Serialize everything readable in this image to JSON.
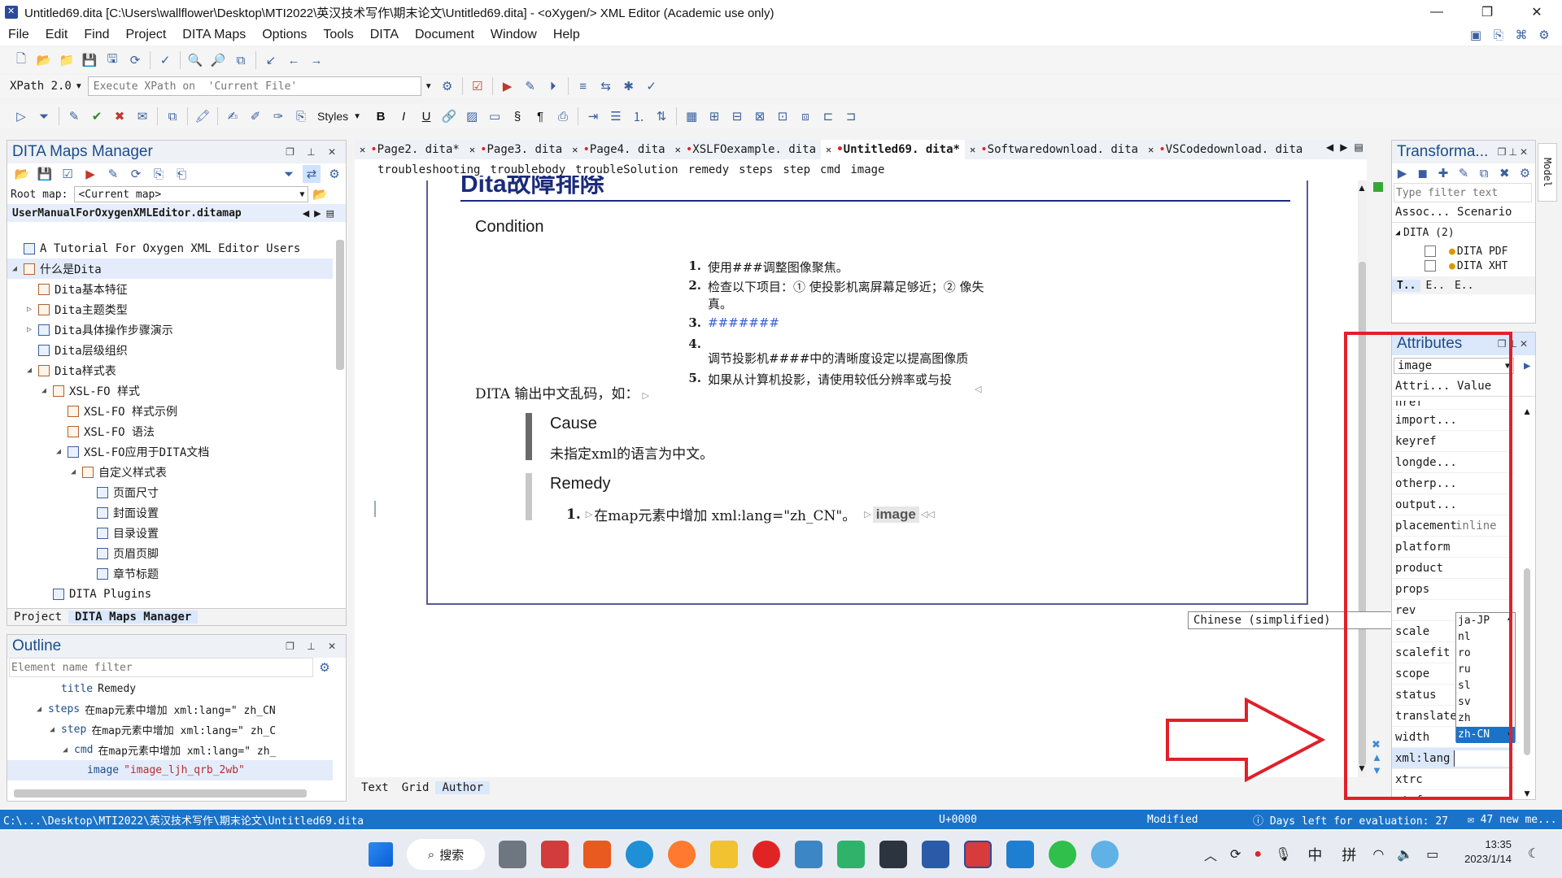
{
  "window": {
    "title": "Untitled69.dita [C:\\Users\\wallflower\\Desktop\\MTI2022\\英汉技术写作\\期末论文\\Untitled69.dita] - <oXygen/> XML Editor (Academic use only)",
    "minimize": "—",
    "maximize": "❐",
    "close": "✕"
  },
  "menu": [
    "File",
    "Edit",
    "Find",
    "Project",
    "DITA Maps",
    "Options",
    "Tools",
    "DITA",
    "Document",
    "Window",
    "Help"
  ],
  "xpath": {
    "version": "XPath 2.0",
    "placeholder": "Execute XPath on  'Current File'"
  },
  "toolbar2": {
    "styles_label": "Styles"
  },
  "dita_maps": {
    "title": "DITA Maps Manager",
    "root_label": "Root map:",
    "root_value": "<Current map>",
    "map_tab": "UserManualForOxygenXMLEditor.ditamap",
    "tree": [
      {
        "label": "A Tutorial For Oxygen XML Editor Users",
        "indent": 0,
        "tw": "",
        "type": "map"
      },
      {
        "label": "什么是Dita",
        "indent": 0,
        "tw": "◢",
        "type": "topic"
      },
      {
        "label": "Dita基本特征",
        "indent": 1,
        "tw": "",
        "type": "topic"
      },
      {
        "label": "Dita主题类型",
        "indent": 1,
        "tw": "▷",
        "type": "topic"
      },
      {
        "label": "Dita具体操作步骤演示",
        "indent": 1,
        "tw": "▷",
        "type": "map"
      },
      {
        "label": "Dita层级组织",
        "indent": 1,
        "tw": "",
        "type": "map"
      },
      {
        "label": "Dita样式表",
        "indent": 1,
        "tw": "◢",
        "type": "topic"
      },
      {
        "label": "XSL-FO 样式",
        "indent": 2,
        "tw": "◢",
        "type": "topic"
      },
      {
        "label": "XSL-FO 样式示例",
        "indent": 3,
        "tw": "",
        "type": "topic"
      },
      {
        "label": "XSL-FO 语法",
        "indent": 3,
        "tw": "",
        "type": "topic"
      },
      {
        "label": "XSL-FO应用于DITA文档",
        "indent": 3,
        "tw": "◢",
        "type": "map"
      },
      {
        "label": "自定义样式表",
        "indent": 4,
        "tw": "◢",
        "type": "topic"
      },
      {
        "label": "页面尺寸",
        "indent": 5,
        "tw": "",
        "type": "map"
      },
      {
        "label": "封面设置",
        "indent": 5,
        "tw": "",
        "type": "map"
      },
      {
        "label": "目录设置",
        "indent": 5,
        "tw": "",
        "type": "map"
      },
      {
        "label": "页眉页脚",
        "indent": 5,
        "tw": "",
        "type": "map"
      },
      {
        "label": "章节标题",
        "indent": 5,
        "tw": "",
        "type": "map"
      },
      {
        "label": "DITA Plugins",
        "indent": 2,
        "tw": "",
        "type": "map"
      }
    ],
    "bottom_tabs": [
      "Project",
      "DITA Maps Manager"
    ]
  },
  "outline": {
    "title": "Outline",
    "filter_placeholder": "Element name filter",
    "rows": [
      {
        "tag": "title",
        "text": "Remedy",
        "indent": 3,
        "tw": ""
      },
      {
        "tag": "steps",
        "text": "在map元素中增加 xml:lang=\" zh_CN",
        "indent": 2,
        "tw": "◢"
      },
      {
        "tag": "step",
        "text": "在map元素中增加 xml:lang=\" zh_C",
        "indent": 3,
        "tw": "◢"
      },
      {
        "tag": "cmd",
        "text": "在map元素中增加 xml:lang=\" zh_",
        "indent": 4,
        "tw": "◢"
      },
      {
        "tag": "image",
        "text": "\"image_ljh_qrb_2wb\"",
        "indent": 5,
        "tw": ""
      }
    ]
  },
  "editor": {
    "tabs": [
      "Page2. dita*",
      "Page3. dita",
      "Page4. dita",
      "XSLFOexample. dita",
      "Untitled69. dita*",
      "Softwaredownload. dita",
      "VSCodedownload. dita"
    ],
    "active_tab": 4,
    "breadcrumb": [
      "troubleshooting",
      "troublebody",
      "troubleSolution",
      "remedy",
      "steps",
      "step",
      "cmd",
      "image"
    ],
    "doc_title": "Dita故障排除",
    "condition_heading": "Condition",
    "condition_items": [
      {
        "n": "1.",
        "text": "使用###调整图像聚焦。"
      },
      {
        "n": "2.",
        "text": "检查以下项目：① 使投影机离屏幕足够近；② 像失真。"
      },
      {
        "n": "3.",
        "text": "#######"
      },
      {
        "n": "4.",
        "text": "调节投影机####中的清晰度设定以提高图像质"
      },
      {
        "n": "5.",
        "text": "如果从计算机投影，请使用较低分辨率或与投"
      }
    ],
    "condition_para": "DITA 输出中文乱码，如：",
    "cause_heading": "Cause",
    "cause_text": "未指定xml的语言为中文。",
    "remedy_heading": "Remedy",
    "remedy_step_n": "1.",
    "remedy_step_text": "在map元素中增加 xml:lang=\"zh_CN\"。",
    "remedy_image_tag": "image",
    "mode_tabs": [
      "Text",
      "Grid",
      "Author"
    ],
    "tooltip": "Chinese (simplified)"
  },
  "transform": {
    "title": "Transforma...",
    "filter_placeholder": "Type filter text",
    "col_assoc": "Assoc...",
    "col_scenario": "Scenario",
    "group": "DITA (2)",
    "items": [
      "DITA PDF",
      "DITA XHT"
    ],
    "tab1": "T..",
    "tab2": "E..",
    "tab3": "E.."
  },
  "attributes": {
    "title": "Attributes",
    "element": "image",
    "col_attr": "Attri...",
    "col_value": "Value",
    "rows": [
      {
        "k": "href",
        "v": ""
      },
      {
        "k": "import...",
        "v": ""
      },
      {
        "k": "keyref",
        "v": ""
      },
      {
        "k": "longde...",
        "v": ""
      },
      {
        "k": "otherp...",
        "v": ""
      },
      {
        "k": "output...",
        "v": ""
      },
      {
        "k": "placement",
        "v": "inline"
      },
      {
        "k": "platform",
        "v": ""
      },
      {
        "k": "product",
        "v": ""
      },
      {
        "k": "props",
        "v": ""
      },
      {
        "k": "rev",
        "v": ""
      },
      {
        "k": "scale",
        "v": ""
      },
      {
        "k": "scalefit",
        "v": ""
      },
      {
        "k": "scope",
        "v": ""
      },
      {
        "k": "status",
        "v": ""
      },
      {
        "k": "translate",
        "v": ""
      },
      {
        "k": "width",
        "v": ""
      },
      {
        "k": "xml:lang",
        "v": ""
      },
      {
        "k": "xtrc",
        "v": ""
      },
      {
        "k": "xtrf",
        "v": ""
      }
    ],
    "dropdown_options": [
      "ja-JP",
      "nl",
      "ro",
      "ru",
      "sl",
      "sv",
      "zh",
      "zh-CN"
    ],
    "dropdown_selected": "zh-CN",
    "model_tab": "Model"
  },
  "statusbar": {
    "path": "C:\\...\\Desktop\\MTI2022\\英汉技术写作\\期末论文\\Untitled69.dita",
    "unicode": "U+0000",
    "state": "Modified",
    "eval": "Days left for evaluation: 27",
    "messages": "47 new me..."
  },
  "taskbar": {
    "search": "搜索",
    "ime1": "中",
    "ime2": "拼",
    "time": "13:35",
    "date": "2023/1/14"
  },
  "colors": {
    "annotation_red": "#e0202a",
    "status_blue": "#1a73c8",
    "link_blue": "#1b4d8c"
  }
}
